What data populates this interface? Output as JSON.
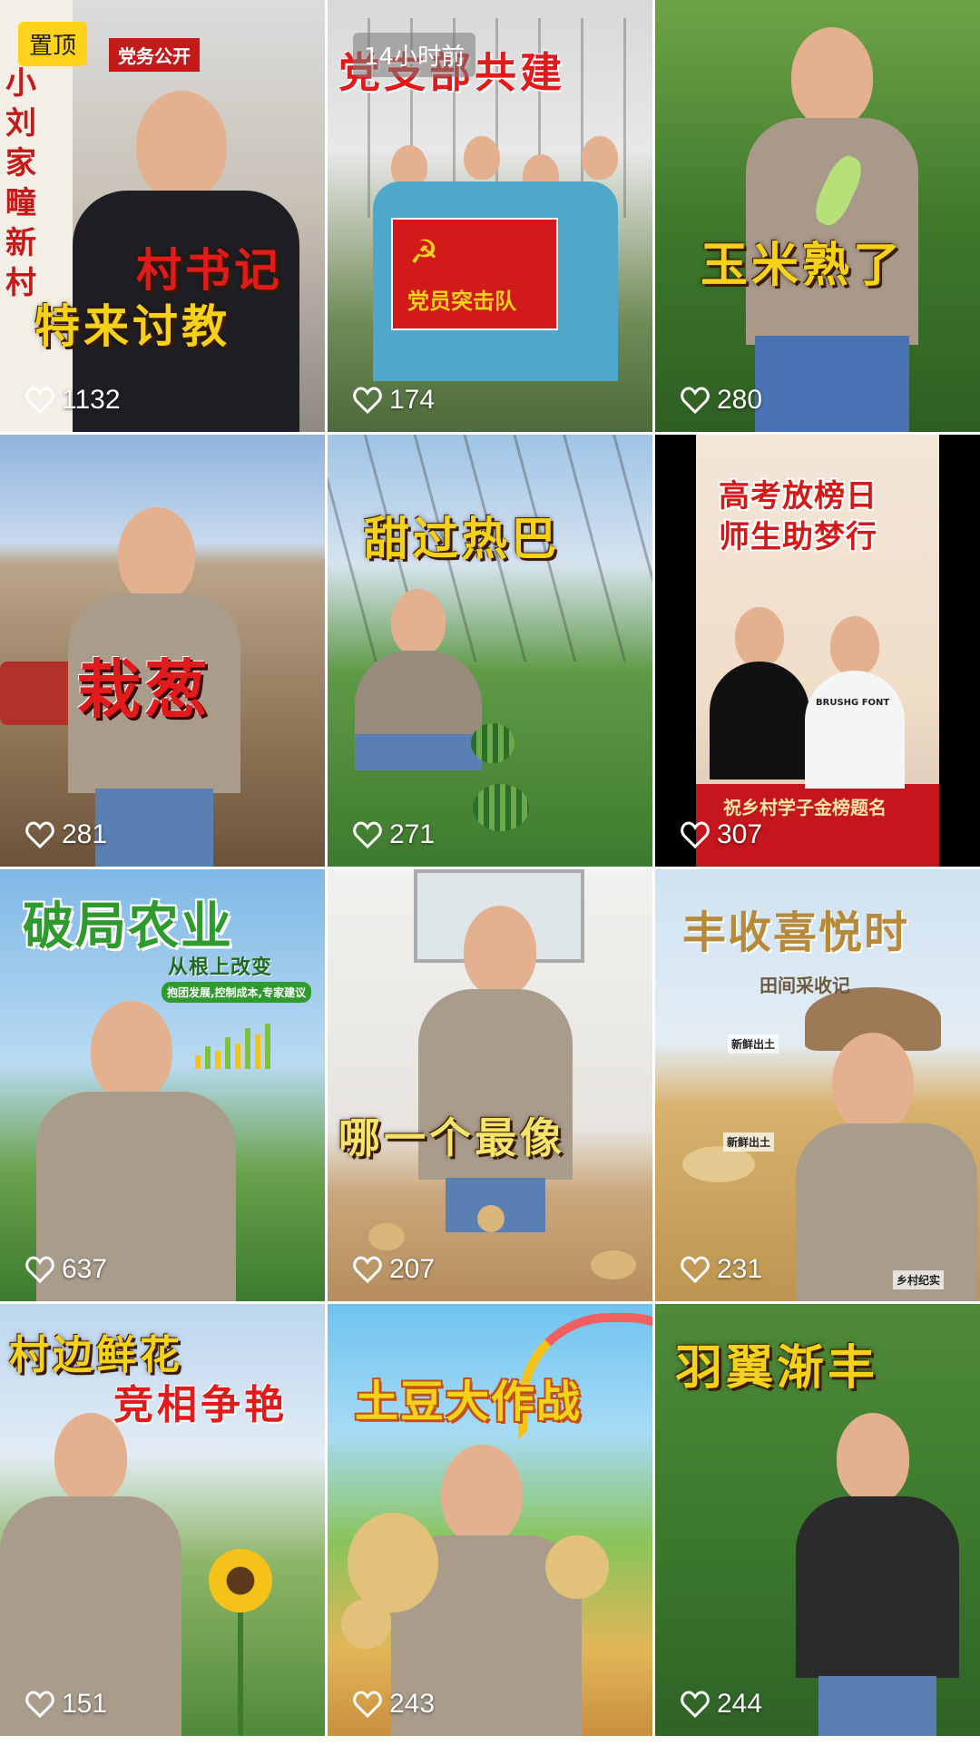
{
  "badges": {
    "pinned": "置顶",
    "time": "14小时前"
  },
  "tiles": [
    {
      "lines": [
        "村书记",
        "特来讨教"
      ],
      "likes": "1132",
      "sign_text": [
        "小",
        "刘",
        "家",
        "疃",
        "新",
        "村"
      ],
      "banner_text": "党务公开"
    },
    {
      "lines": [
        "党支部共建"
      ],
      "likes": "174",
      "flag_text": "党员突击队"
    },
    {
      "lines": [
        "玉米熟了"
      ],
      "likes": "280"
    },
    {
      "lines": [
        "栽葱"
      ],
      "likes": "281"
    },
    {
      "lines": [
        "甜过热巴"
      ],
      "likes": "271"
    },
    {
      "lines": [
        "高考放榜日",
        "师生助梦行"
      ],
      "likes": "307",
      "footer_text": "祝乡村学子金榜题名",
      "shirt_text": "BRUSHG FONT"
    },
    {
      "lines": [
        "破局农业",
        "从根上改变",
        "抱团发展,控制成本,专家建议"
      ],
      "likes": "637"
    },
    {
      "lines": [
        "哪一个最像"
      ],
      "likes": "207"
    },
    {
      "lines": [
        "丰收喜悦时",
        "田间采收记"
      ],
      "likes": "231",
      "small_labels": [
        "新鲜出土",
        "新鲜出土",
        "乡村纪实"
      ]
    },
    {
      "lines": [
        "村边鲜花",
        "竞相争艳"
      ],
      "likes": "151"
    },
    {
      "lines": [
        "土豆大作战"
      ],
      "likes": "243"
    },
    {
      "lines": [
        "羽翼渐丰"
      ],
      "likes": "244"
    }
  ],
  "colors": {
    "gold": "#f5d21a",
    "red": "#e11b1b",
    "green": "#2f9a2e",
    "white": "#ffffff"
  }
}
